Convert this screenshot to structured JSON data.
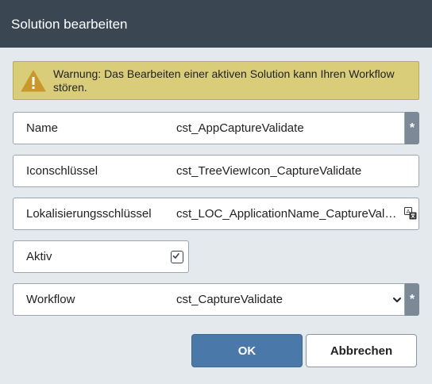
{
  "dialog": {
    "title": "Solution bearbeiten"
  },
  "warning": {
    "icon": "warning-triangle-icon",
    "text": "Warnung: Das Bearbeiten einer aktiven Solution kann Ihren Workflow stören."
  },
  "fields": {
    "name": {
      "label": "Name",
      "value": "cst_AppCaptureValidate",
      "required_mark": "*"
    },
    "icon_key": {
      "label": "Iconschlüssel",
      "value": "cst_TreeViewIcon_CaptureValidate"
    },
    "localization_key": {
      "label": "Lokalisierungsschlüssel",
      "value": "cst_LOC_ApplicationName_CaptureValidate",
      "icon": "translate-icon"
    },
    "active": {
      "label": "Aktiv",
      "checked": true
    },
    "workflow": {
      "label": "Workflow",
      "selected": "cst_CaptureValidate",
      "required_mark": "*"
    }
  },
  "buttons": {
    "ok": "OK",
    "cancel": "Abbrechen"
  },
  "colors": {
    "titlebar": "#3b4653",
    "background": "#e4e9ee",
    "warning_bg": "#d9cd7a",
    "primary_button": "#4a78a8",
    "required_marker": "#7d8996"
  }
}
